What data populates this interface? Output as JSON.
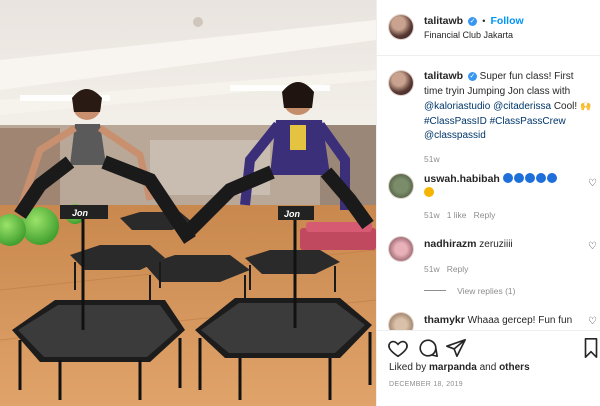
{
  "post": {
    "username": "talitawb",
    "follow_label": "Follow",
    "separator": "•",
    "location": "Financial Club Jakarta"
  },
  "caption": {
    "username": "talitawb",
    "text": "Super fun class! First time tryin Jumping Jon class with",
    "mentions": [
      "@kaloriastudio",
      "@citaderissa"
    ],
    "after_mentions": "Cool!",
    "hashtags": [
      "#ClassPassID",
      "#ClassPassCrew"
    ],
    "mention_last": "@classpassid",
    "age": "51w"
  },
  "photo": {
    "brand_text": "Jon"
  },
  "comments": [
    {
      "username": "uswah.habibah",
      "text": "",
      "age": "51w",
      "likes": "1 like",
      "reply": "Reply",
      "heart_emoji_count": 5
    },
    {
      "username": "nadhirazm",
      "text": "zeruziiii",
      "age": "51w",
      "reply": "Reply"
    },
    {
      "username": "thamykr",
      "text": "Whaaa gercep! Fun fun"
    }
  ],
  "view_replies": "View replies (1)",
  "engagement": {
    "liked_by_prefix": "Liked by ",
    "liked_by_user": "marpanda",
    "and": " and ",
    "others": "others",
    "date": "DECEMBER 18, 2019"
  },
  "icons": [
    "heart-icon",
    "comment-icon",
    "share-icon",
    "bookmark-icon",
    "verified-icon"
  ],
  "colors": {
    "accent": "#0095f6",
    "verified": "#3897f0",
    "muted": "#8e8e8e",
    "link": "#00376b"
  }
}
